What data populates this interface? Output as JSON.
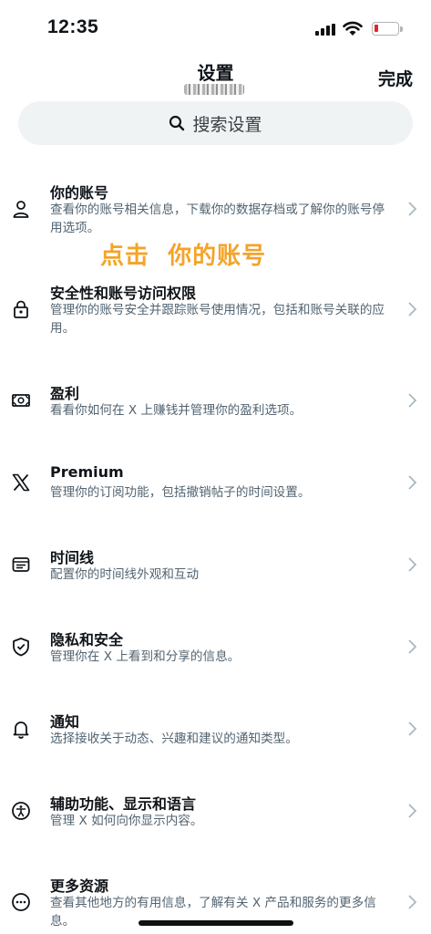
{
  "status_bar": {
    "time": "12:35"
  },
  "header": {
    "title": "设置",
    "done_label": "完成"
  },
  "search": {
    "placeholder": "搜索设置"
  },
  "annotation": "点击  你的账号",
  "settings": [
    {
      "title": "你的账号",
      "desc": "查看你的账号相关信息，下载你的数据存档或了解你的账号停用选项。",
      "icon": "person-icon"
    },
    {
      "title": "安全性和账号访问权限",
      "desc": "管理你的账号安全并跟踪账号使用情况，包括和账号关联的应用。",
      "icon": "lock-icon"
    },
    {
      "title": "盈利",
      "desc": "看看你如何在 X 上赚钱并管理你的盈利选项。",
      "icon": "money-icon"
    },
    {
      "title": "Premium",
      "desc": "管理你的订阅功能，包括撤销帖子的时间设置。",
      "icon": "x-logo-icon"
    },
    {
      "title": "时间线",
      "desc": "配置你的时间线外观和互动",
      "icon": "timeline-icon"
    },
    {
      "title": "隐私和安全",
      "desc": "管理你在 X 上看到和分享的信息。",
      "icon": "shield-icon"
    },
    {
      "title": "通知",
      "desc": "选择接收关于动态、兴趣和建议的通知类型。",
      "icon": "bell-icon"
    },
    {
      "title": "辅助功能、显示和语言",
      "desc": "管理 X 如何向你显示内容。",
      "icon": "accessibility-icon"
    },
    {
      "title": "更多资源",
      "desc": "查看其他地方的有用信息，了解有关 X 产品和服务的更多信息。",
      "icon": "more-icon"
    }
  ]
}
